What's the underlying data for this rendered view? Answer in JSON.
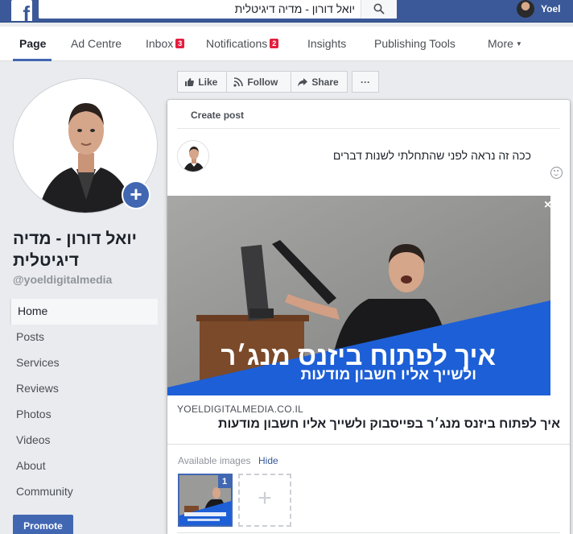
{
  "topbar": {
    "search_value": "יואל דורון - מדיה דיגיטלית",
    "user_name": "Yoel"
  },
  "nav": {
    "tabs": [
      {
        "label": "Page",
        "active": true
      },
      {
        "label": "Ad Centre"
      },
      {
        "label": "Inbox",
        "badge": "3"
      },
      {
        "label": "Notifications",
        "badge": "2"
      },
      {
        "label": "Insights"
      },
      {
        "label": "Publishing Tools"
      },
      {
        "label": "More"
      }
    ]
  },
  "profile": {
    "name": "יואל דורון - מדיה דיגיטלית",
    "handle": "@yoeldigitalmedia"
  },
  "sidebar": {
    "items": [
      {
        "label": "Home",
        "active": true
      },
      {
        "label": "Posts"
      },
      {
        "label": "Services"
      },
      {
        "label": "Reviews"
      },
      {
        "label": "Photos"
      },
      {
        "label": "Videos"
      },
      {
        "label": "About"
      },
      {
        "label": "Community"
      }
    ],
    "promote_label": "Promote"
  },
  "actions": {
    "like": "Like",
    "follow": "Follow",
    "share": "Share",
    "more": "···"
  },
  "composer": {
    "title": "Create post",
    "text": "ככה זה נראה לפני שהתחלתי לשנות דברים",
    "preview": {
      "banner_title": "איך לפתוח ביזנס מנג׳ר",
      "banner_subtitle": "ולשייך אליו חשבון מודעות",
      "domain": "YOELDIGITALMEDIA.CO.IL",
      "link_title": "איך לפתוח ביזנס מנג׳ר בפייסבוק ולשייך אליו חשבון מודעות",
      "close": "×"
    },
    "available_images_label": "Available images",
    "hide_label": "Hide",
    "thumb_count": "1",
    "add_image": "+"
  },
  "colors": {
    "brand_blue": "#3b5998",
    "accent_blue": "#4267b2",
    "badge_red": "#e41e3f",
    "banner_blue": "#1d5fd6"
  }
}
